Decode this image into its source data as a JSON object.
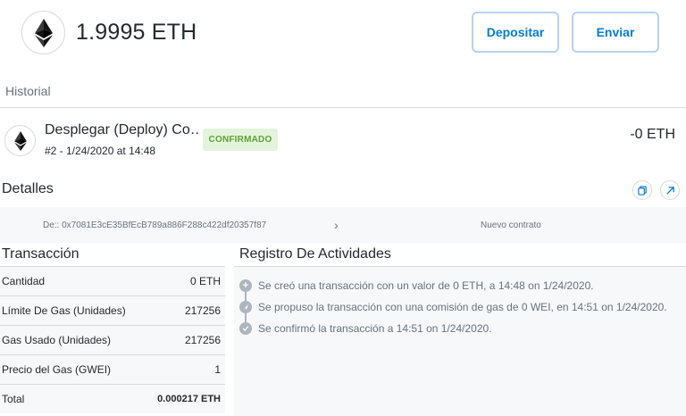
{
  "header": {
    "balance": "1.9995 ETH",
    "deposit_label": "Depositar",
    "send_label": "Enviar"
  },
  "history": {
    "label": "Historial"
  },
  "transaction": {
    "title": "Desplegar (Deploy) Co…",
    "subtitle": "#2 - 1/24/2020 at 14:48",
    "status": "CONFIRMADO",
    "amount": "-0 ETH"
  },
  "details": {
    "label": "Detalles",
    "from": "De:: 0x7081E3cE35BfEcB789a886F288c422df20357f87",
    "arrow": "›",
    "to": "Nuevo contrato"
  },
  "tx_breakdown": {
    "title": "Transacción",
    "rows": [
      {
        "label": "Cantidad",
        "value": "0 ETH"
      },
      {
        "label": "Límite De Gas (Unidades)",
        "value": "217256"
      },
      {
        "label": "Gas Usado (Unidades)",
        "value": "217256"
      },
      {
        "label": "Precio del Gas (GWEI)",
        "value": "1"
      },
      {
        "label": "Total",
        "value": "0.000217 ETH"
      }
    ]
  },
  "activity_log": {
    "title": "Registro De Actividades",
    "items": [
      {
        "icon": "plus-icon",
        "text": "Se creó una transacción con un valor de 0 ETH, a 14:48 on 1/24/2020."
      },
      {
        "icon": "paper-plane-icon",
        "text": "Se propuso la transacción con una comisión de gas de 0 WEI, en 14:51 on 1/24/2020."
      },
      {
        "icon": "check-icon",
        "text": "Se confirmó la transacción a 14:51 on 1/24/2020."
      }
    ]
  },
  "colors": {
    "accent": "#037dd6",
    "confirmed_bg": "#e4f3dc",
    "confirmed_text": "#5ea133"
  }
}
